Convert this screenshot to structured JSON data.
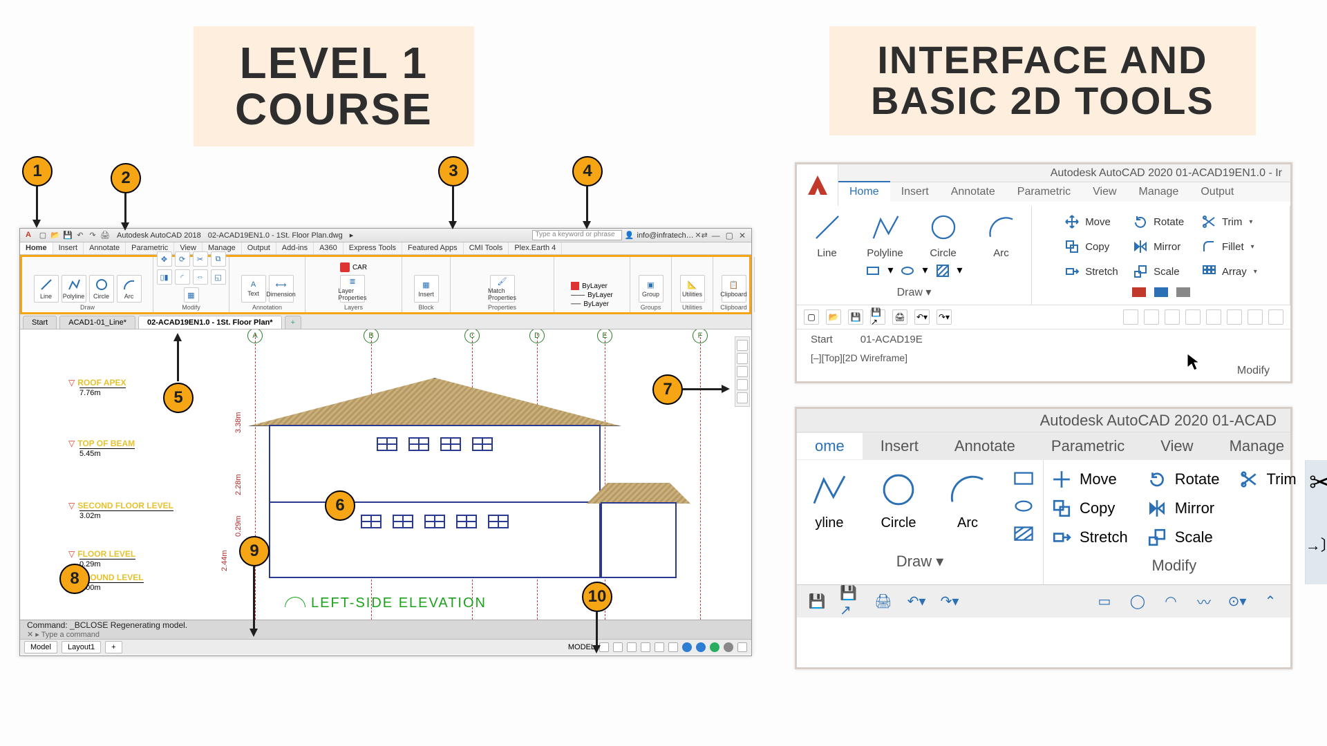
{
  "headings": {
    "left_line1": "LEVEL 1",
    "left_line2": "COURSE",
    "right_line1": "INTERFACE AND",
    "right_line2": "BASIC 2D TOOLS"
  },
  "callouts": {
    "n1": "1",
    "n2": "2",
    "n3": "3",
    "n4": "4",
    "n5": "5",
    "n6": "6",
    "n7": "7",
    "n8": "8",
    "n9": "9",
    "n10": "10"
  },
  "main": {
    "app_name": "Autodesk AutoCAD 2018",
    "doc_name": "02-ACAD19EN1.0 - 1St. Floor Plan.dwg",
    "search_placeholder": "Type a keyword or phrase",
    "signin": "info@infratech…",
    "menus": [
      "Home",
      "Insert",
      "Annotate",
      "Parametric",
      "View",
      "Manage",
      "Output",
      "Add-ins",
      "A360",
      "Express Tools",
      "Featured Apps",
      "CMI Tools",
      "Plex.Earth 4"
    ],
    "ribbon_panels": {
      "draw": "Draw",
      "modify": "Modify",
      "annotate": "Annotation",
      "layers": "Layers",
      "block": "Block",
      "properties": "Properties",
      "groups": "Groups",
      "utilities": "Utilities",
      "clipboard": "Clipboard"
    },
    "draw_tools": {
      "line": "Line",
      "polyline": "Polyline",
      "circle": "Circle",
      "arc": "Arc"
    },
    "anno_tools": {
      "text": "Text",
      "dim": "Dimension",
      "layerprops": "Layer\nProperties"
    },
    "layer_current": "CAR",
    "props_bylayer": "ByLayer",
    "block_tools": {
      "insert": "Insert",
      "match": "Match\nProperties",
      "group": "Group",
      "utilities": "Utilities",
      "clipboard": "Clipboard"
    },
    "tabs": {
      "start": "Start",
      "t1": "ACAD1-01_Line*",
      "t2": "02-ACAD19EN1.0 - 1St. Floor Plan*"
    },
    "levels": {
      "roof": {
        "name": "ROOF APEX",
        "val": "7.76m"
      },
      "beam": {
        "name": "TOP OF BEAM",
        "val": "5.45m"
      },
      "second": {
        "name": "SECOND FLOOR LEVEL",
        "val": "3.02m"
      },
      "floor": {
        "name": "FLOOR LEVEL",
        "val": "0.29m"
      },
      "ground": {
        "name": "GROUND LEVEL",
        "val": "0.00m"
      }
    },
    "dims": {
      "d1": "3.38m",
      "d2": "2.28m",
      "d3": "0.29m",
      "d4": "2.44m"
    },
    "grids": [
      "A",
      "B",
      "C",
      "D",
      "E",
      "F"
    ],
    "elev_title": "LEFT-SIDE ELEVATION",
    "cmd": "Command: _BCLOSE Regenerating model.",
    "cmd_prompt": "Type a command",
    "layouts": {
      "model": "Model",
      "layout1": "Layout1"
    },
    "status_model": "MODEL"
  },
  "card1": {
    "title": "Autodesk AutoCAD 2020   01-ACAD19EN1.0 - Ir",
    "tabs": [
      "Home",
      "Insert",
      "Annotate",
      "Parametric",
      "View",
      "Manage",
      "Output"
    ],
    "draw": {
      "line": "Line",
      "polyline": "Polyline",
      "circle": "Circle",
      "arc": "Arc"
    },
    "draw_label": "Draw ▾",
    "modify": {
      "move": "Move",
      "rotate": "Rotate",
      "trim": "Trim",
      "copy": "Copy",
      "mirror": "Mirror",
      "fillet": "Fillet",
      "stretch": "Stretch",
      "scale": "Scale",
      "array": "Array"
    },
    "modify_label": "Modify",
    "start": "Start",
    "doc": "01-ACAD19E",
    "viewmode": "[–][Top][2D Wireframe]"
  },
  "card2": {
    "title": "Autodesk AutoCAD 2020   01-ACAD",
    "tabs": [
      "ome",
      "Insert",
      "Annotate",
      "Parametric",
      "View",
      "Manage"
    ],
    "draw": {
      "polyline": "yline",
      "circle": "Circle",
      "arc": "Arc"
    },
    "draw_label": "Draw ▾",
    "modify": {
      "move": "Move",
      "rotate": "Rotate",
      "trim": "Trim",
      "copy": "Copy",
      "mirror": "Mirror",
      "stretch": "Stretch",
      "scale": "Scale"
    },
    "modify_label": "Modify"
  }
}
